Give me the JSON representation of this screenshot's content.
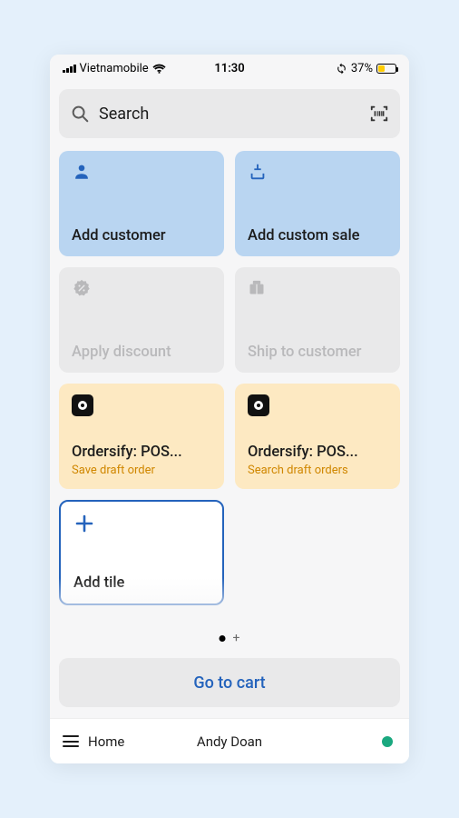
{
  "status": {
    "carrier": "Vietnamobile",
    "time": "11:30",
    "battery_pct": "37%",
    "battery_level": 37
  },
  "search": {
    "placeholder": "Search"
  },
  "tiles": {
    "add_customer": {
      "title": "Add customer"
    },
    "add_custom_sale": {
      "title": "Add custom sale"
    },
    "apply_discount": {
      "title": "Apply discount"
    },
    "ship_to_customer": {
      "title": "Ship to customer"
    },
    "ordersify_save": {
      "title": "Ordersify: POS...",
      "subtitle": "Save draft order"
    },
    "ordersify_search": {
      "title": "Ordersify: POS...",
      "subtitle": "Search draft orders"
    },
    "add_tile": {
      "title": "Add tile"
    }
  },
  "cart_button": "Go to cart",
  "nav": {
    "home_label": "Home",
    "user_name": "Andy Doan"
  }
}
